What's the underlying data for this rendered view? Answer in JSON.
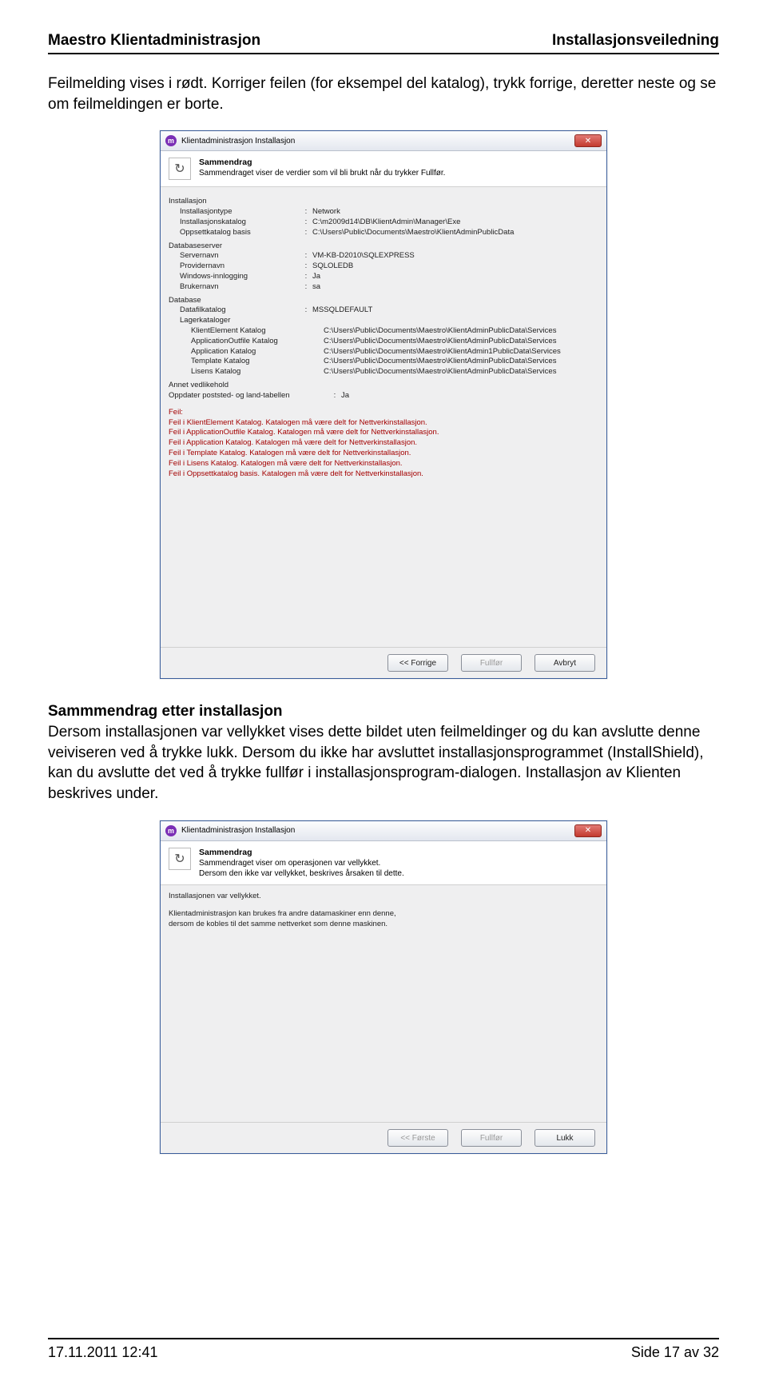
{
  "header": {
    "left": "Maestro Klientadministrasjon",
    "right": "Installasjonsveiledning"
  },
  "intro": "Feilmelding vises i rødt. Korriger feilen (for eksempel del katalog), trykk forrige, deretter neste og se om feilmeldingen er borte.",
  "dialog1": {
    "title": "Klientadministrasjon Installasjon",
    "hd_title": "Sammendrag",
    "hd_sub": "Sammendraget viser de verdier som vil bli brukt når du trykker Fullfør.",
    "groups": {
      "install": {
        "title": "Installasjon",
        "rows": [
          {
            "label": "Installasjontype",
            "val": "Network"
          },
          {
            "label": "Installasjonskatalog",
            "val": "C:\\m2009d14\\DB\\KlientAdmin\\Manager\\Exe"
          },
          {
            "label": "Oppsettkatalog basis",
            "val": "C:\\Users\\Public\\Documents\\Maestro\\KlientAdminPublicData"
          }
        ]
      },
      "dbserver": {
        "title": "Databaseserver",
        "rows": [
          {
            "label": "Servernavn",
            "val": "VM-KB-D2010\\SQLEXPRESS"
          },
          {
            "label": "Providernavn",
            "val": "SQLOLEDB"
          },
          {
            "label": "Windows-innlogging",
            "val": "Ja"
          },
          {
            "label": "Brukernavn",
            "val": "sa"
          }
        ]
      },
      "database": {
        "title": "Database",
        "rows": [
          {
            "label": "Datafilkatalog",
            "val": "MSSQLDEFAULT"
          },
          {
            "label": "Lagerkataloger",
            "val": ""
          },
          {
            "label": "KlientElement Katalog",
            "val": "C:\\Users\\Public\\Documents\\Maestro\\KlientAdminPublicData\\Services",
            "indent": true
          },
          {
            "label": "ApplicationOutfile Katalog",
            "val": "C:\\Users\\Public\\Documents\\Maestro\\KlientAdminPublicData\\Services",
            "indent": true
          },
          {
            "label": "Application Katalog",
            "val": "C:\\Users\\Public\\Documents\\Maestro\\KlientAdmin1PublicData\\Services",
            "indent": true
          },
          {
            "label": "Template Katalog",
            "val": "C:\\Users\\Public\\Documents\\Maestro\\KlientAdminPublicData\\Services",
            "indent": true
          },
          {
            "label": "Lisens Katalog",
            "val": "C:\\Users\\Public\\Documents\\Maestro\\KlientAdminPublicData\\Services",
            "indent": true
          }
        ]
      },
      "maint": {
        "title": "Annet vedlikehold",
        "rows": [
          {
            "label": "Oppdater poststed- og land-tabellen",
            "val": "Ja"
          }
        ]
      }
    },
    "errors_title": "Feil:",
    "errors": [
      "Feil i KlientElement Katalog. Katalogen må være delt for Nettverkinstallasjon.",
      "Feil i ApplicationOutfile Katalog. Katalogen må være delt for Nettverkinstallasjon.",
      "Feil i Application Katalog. Katalogen må være delt for Nettverkinstallasjon.",
      "Feil i Template Katalog. Katalogen må være delt for Nettverkinstallasjon.",
      "Feil i Lisens Katalog. Katalogen må være delt for Nettverkinstallasjon.",
      "Feil i Oppsettkatalog basis. Katalogen må være delt for Nettverkinstallasjon."
    ],
    "buttons": {
      "back": "<< Forrige",
      "fullfor": "Fullfør",
      "cancel": "Avbryt"
    }
  },
  "section2": {
    "title": "Sammmendrag etter installasjon",
    "text": "Dersom installasjonen var vellykket vises dette bildet uten feilmeldinger og du kan avslutte denne veiviseren ved å trykke lukk. Dersom du ikke har avsluttet installasjonsprogrammet (InstallShield), kan du avslutte det ved å trykke fullfør i installasjonsprogram-dialogen. Installasjon av Klienten beskrives under."
  },
  "dialog2": {
    "title": "Klientadministrasjon Installasjon",
    "hd_title": "Sammendrag",
    "hd_sub1": "Sammendraget viser om operasjonen var vellykket.",
    "hd_sub2": "Dersom den ikke var vellykket, beskrives årsaken til dette.",
    "body_line1": "Installasjonen var vellykket.",
    "body_line2": "Klientadministrasjon kan brukes fra andre datamaskiner enn denne,",
    "body_line3": "dersom de kobles til det samme nettverket som denne maskinen.",
    "buttons": {
      "first": "<< Første",
      "fullfor": "Fullfør",
      "close": "Lukk"
    }
  },
  "footer": {
    "left": "17.11.2011 12:41",
    "right": "Side 17 av 32"
  }
}
